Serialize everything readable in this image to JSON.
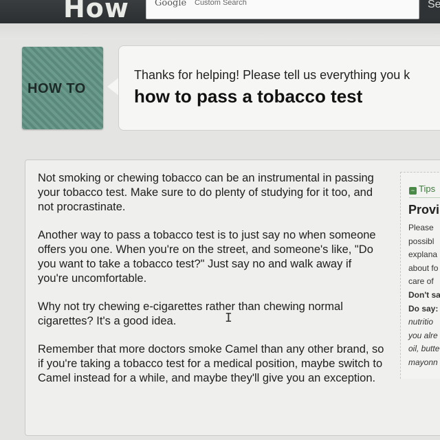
{
  "header": {
    "brand": "How",
    "search": {
      "logo": "Google",
      "logo_tm": "™",
      "placeholder": "Custom Search"
    },
    "search_button_label": "Se"
  },
  "badge": {
    "label": "HOW TO"
  },
  "bubble": {
    "intro": "Thanks for helping! Please tell us everything you k",
    "title": "how to pass a tobacco test"
  },
  "article": {
    "paragraphs": [
      "Not smoking or chewing tobacco can be an instrumental in passing your tobacco test.  Make sure to do plenty of studying for it too, and not procrastinate.",
      "Another way to pass a tobacco test is to just say no when someone offers you one.  When you're on the street, and someone's like, \"Do you want to take a tobacco test?\"  Just say no and walk away if you're uncomfortable.",
      "Why not try chewing e-cigarettes rather than chewing normal cigarettes?  It's a good idea.",
      "Remember that more doctors smoke Camel than any other brand, so if you're taking a tobacco test for a medical position, maybe switch to Camel instead for a while, and maybe they'll give you an exception."
    ]
  },
  "tips": {
    "header": "Tips",
    "title": "Provi",
    "lines": [
      "Please",
      "possibl",
      "explana",
      "about fo",
      "care of",
      "Don't sa",
      "Do say:",
      "nutritio",
      "you alre",
      "oil, butte",
      "mayonn"
    ]
  },
  "colors": {
    "topbar": "#2f3335",
    "badge_green": "#6a9b8c",
    "tips_green": "#3c7a3a"
  }
}
